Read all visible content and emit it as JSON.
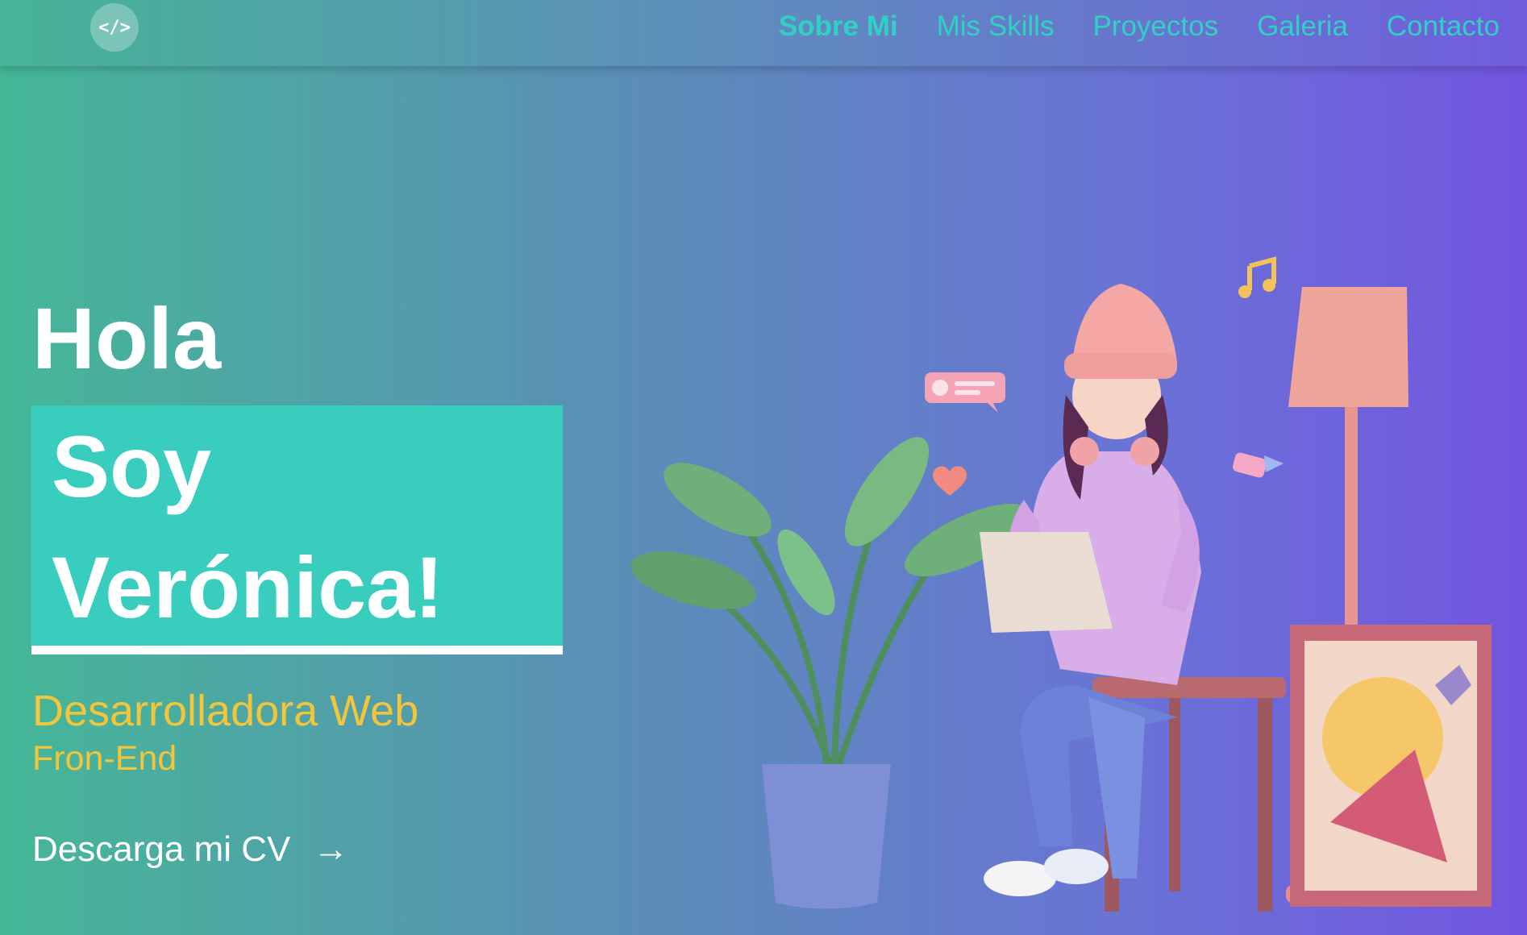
{
  "nav": {
    "logo_glyph": "</>",
    "links": [
      {
        "label": "Sobre Mi",
        "active": true
      },
      {
        "label": "Mis Skills"
      },
      {
        "label": "Proyectos"
      },
      {
        "label": "Galeria"
      },
      {
        "label": "Contacto"
      }
    ]
  },
  "hero": {
    "greeting": "Hola",
    "name_line_1": "Soy",
    "name_line_2": "Verónica!",
    "role": "Desarrolladora Web",
    "subrole": "Fron-End",
    "cv_label": "Descarga mi CV",
    "cv_arrow": "→",
    "illustration_icon": "developer-girl-illustration"
  },
  "colors": {
    "accent_teal": "#38cdbd",
    "nav_text": "#31d0c4",
    "role_yellow": "#f3c53a"
  }
}
